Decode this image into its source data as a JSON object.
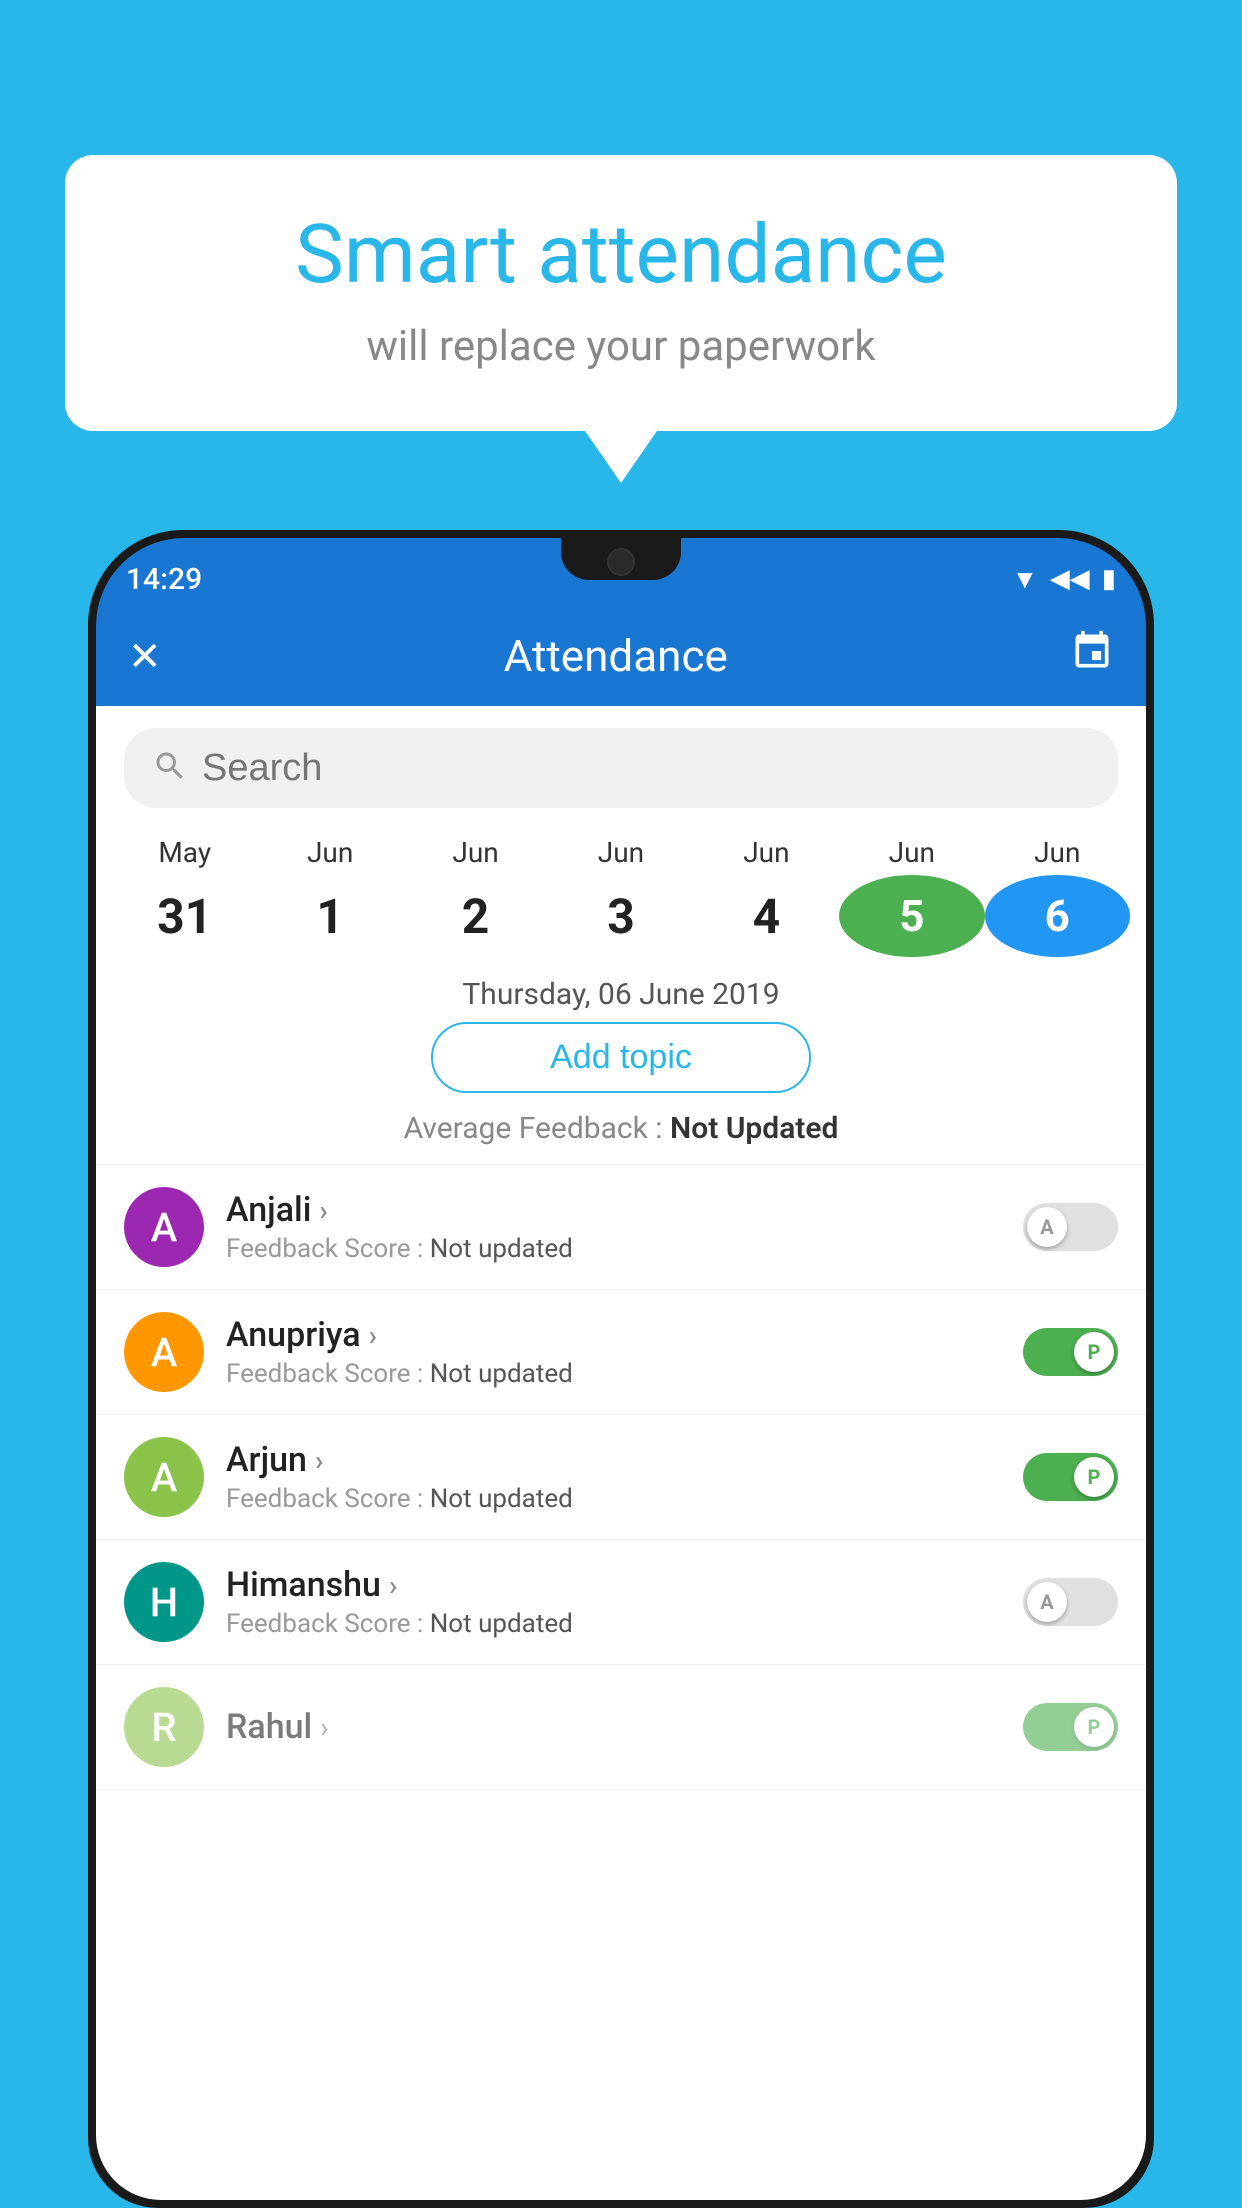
{
  "background_color": "#29b6e8",
  "speech_bubble": {
    "title": "Smart attendance",
    "subtitle": "will replace your paperwork"
  },
  "status_bar": {
    "time": "14:29",
    "wifi_icon": "▾▾",
    "signal_icon": "◂◂",
    "battery_icon": "▮"
  },
  "app_header": {
    "close_label": "✕",
    "title": "Attendance",
    "calendar_icon": "📅"
  },
  "search": {
    "placeholder": "Search"
  },
  "calendar": {
    "months": [
      "May",
      "Jun",
      "Jun",
      "Jun",
      "Jun",
      "Jun",
      "Jun"
    ],
    "dates": [
      "31",
      "1",
      "2",
      "3",
      "4",
      "5",
      "6"
    ],
    "selected_green": "5",
    "selected_blue": "6"
  },
  "selected_date_label": "Thursday, 06 June 2019",
  "add_topic_label": "Add topic",
  "average_feedback": {
    "label": "Average Feedback : ",
    "value": "Not Updated"
  },
  "students": [
    {
      "name": "Anjali",
      "avatar_letter": "A",
      "avatar_color_class": "avatar-purple",
      "feedback_label": "Feedback Score : ",
      "feedback_value": "Not updated",
      "toggle": "absent"
    },
    {
      "name": "Anupriya",
      "avatar_letter": "A",
      "avatar_color_class": "avatar-orange",
      "feedback_label": "Feedback Score : ",
      "feedback_value": "Not updated",
      "toggle": "present"
    },
    {
      "name": "Arjun",
      "avatar_letter": "A",
      "avatar_color_class": "avatar-green-light",
      "feedback_label": "Feedback Score : ",
      "feedback_value": "Not updated",
      "toggle": "present"
    },
    {
      "name": "Himanshu",
      "avatar_letter": "H",
      "avatar_color_class": "avatar-teal",
      "feedback_label": "Feedback Score : ",
      "feedback_value": "Not updated",
      "toggle": "absent"
    }
  ]
}
